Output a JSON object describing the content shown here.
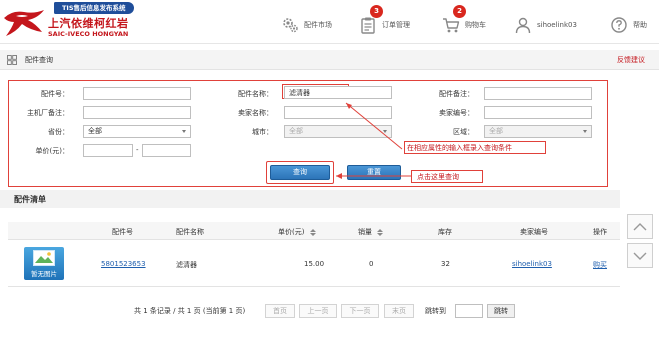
{
  "header": {
    "badge_text": "TIS售后信息发布系统",
    "brand_cn": "上汽依维柯红岩",
    "brand_en": "SAIC-IVECO HONGYAN",
    "nav": [
      {
        "label": "配件市场",
        "icon": "gear-icon"
      },
      {
        "label": "订单管理",
        "icon": "clipboard-icon",
        "count": "3"
      },
      {
        "label": "购物车",
        "icon": "cart-icon",
        "count": "2"
      },
      {
        "label": "sihoelink03",
        "icon": "user-icon"
      },
      {
        "label": "帮助",
        "icon": "help-icon"
      }
    ],
    "brand_color": "#c4161c"
  },
  "breadcrumb": {
    "title": "配件查询",
    "feedback": "反馈建议"
  },
  "query": {
    "part_no_label": "配件号：",
    "part_no_value": "",
    "part_name_label": "配件名称：",
    "part_name_value": "滤清器",
    "part_remark_label": "配件备注：",
    "part_remark_value": "",
    "mfr_remark_label": "主机厂备注：",
    "mfr_remark_value": "",
    "seller_name_label": "卖家名称：",
    "seller_name_value": "",
    "seller_no_label": "卖家编号：",
    "seller_no_value": "",
    "province_label": "省份：",
    "province_value": "全部",
    "city_label": "城市：",
    "city_value": "全部",
    "district_label": "区域：",
    "district_value": "全部",
    "price_label": "单价(元)：",
    "price_from": "",
    "price_to": "",
    "price_sep": "-",
    "search_button": "查询",
    "reset_button": "重置",
    "annotation_input": "在相应属性的输入框录入查询条件",
    "annotation_button": "点击这里查询"
  },
  "list": {
    "title": "配件清单",
    "columns": [
      "配件号",
      "配件名称",
      "单价(元)",
      "销量",
      "库存",
      "卖家编号",
      "操作"
    ],
    "rows": [
      {
        "image_label": "暂无图片",
        "part_no": "5801523653",
        "part_name": "滤清器",
        "price": "15.00",
        "sales": "0",
        "stock": "32",
        "seller_no": "sihoelink03",
        "action": "购买"
      }
    ]
  },
  "pager": {
    "summary": "共 1 条记录 / 共 1 页 (当前第 1 页)",
    "first": "首页",
    "prev": "上一页",
    "next": "下一页",
    "last": "末页",
    "jump_label": "跳转到",
    "jump_value": "",
    "jump_button": "跳转"
  }
}
